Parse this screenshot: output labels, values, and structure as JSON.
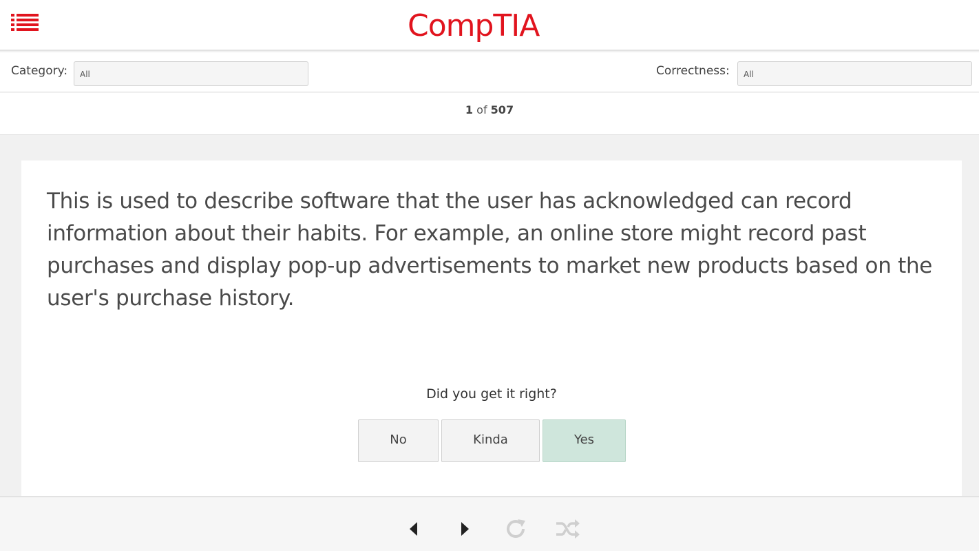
{
  "header": {
    "logo_text": "CompTIA",
    "brand_color": "#e1141e",
    "menu_icon": "list-menu-icon"
  },
  "filters": {
    "category_label": "Category:",
    "category_value": "All",
    "correctness_label": "Correctness:",
    "correctness_value": "All"
  },
  "counter": {
    "current": "1",
    "separator": "of",
    "total": "507"
  },
  "card": {
    "question": "This is used to describe software that the user has acknowledged can record information about their habits. For example, an online store might record past purchases and display pop-up advertisements to market new products based on the user's purchase history.",
    "prompt": "Did you get it right?",
    "buttons": {
      "no": "No",
      "kinda": "Kinda",
      "yes": "Yes"
    },
    "yes_color": "#cfe6dc"
  },
  "footer": {
    "icons": [
      "previous-icon",
      "next-icon",
      "refresh-icon",
      "shuffle-icon"
    ]
  }
}
